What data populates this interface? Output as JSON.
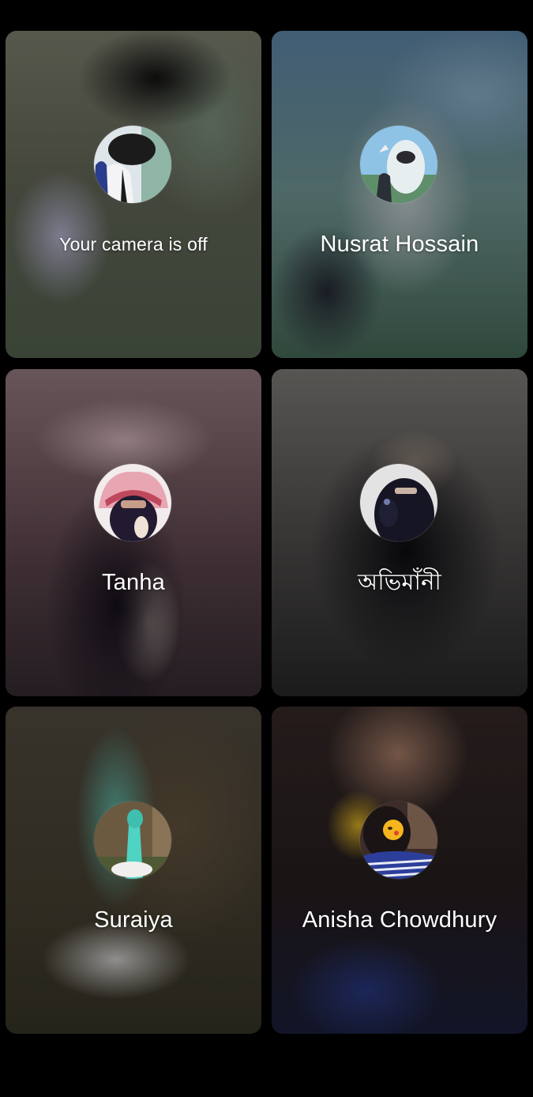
{
  "call_grid": {
    "participants": [
      {
        "name": "Your camera is off",
        "avatar_icon": "avatar-photo-self"
      },
      {
        "name": "Nusrat Hossain",
        "avatar_icon": "avatar-photo"
      },
      {
        "name": "Tanha",
        "avatar_icon": "avatar-photo"
      },
      {
        "name": "অভিমাঁনী",
        "avatar_icon": "avatar-photo"
      },
      {
        "name": "Suraiya",
        "avatar_icon": "avatar-photo"
      },
      {
        "name": "Anisha Chowdhury",
        "avatar_icon": "avatar-photo"
      }
    ]
  },
  "colors": {
    "background": "#000000",
    "label_text": "#ffffff"
  }
}
